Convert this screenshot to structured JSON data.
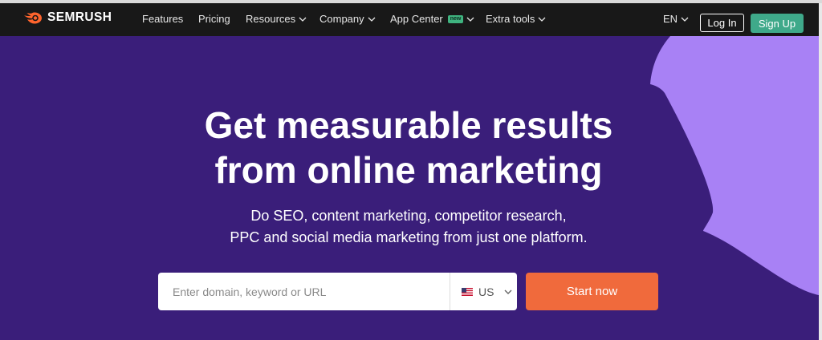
{
  "brand": {
    "name": "SEMRUSH",
    "logo_icon": "semrush-fireball-icon",
    "accent": "#ff642d"
  },
  "nav": {
    "items": [
      {
        "label": "Features",
        "dropdown": false
      },
      {
        "label": "Pricing",
        "dropdown": false
      },
      {
        "label": "Resources",
        "dropdown": true
      },
      {
        "label": "Company",
        "dropdown": true
      },
      {
        "label": "App Center",
        "dropdown": true,
        "badge": "new"
      },
      {
        "label": "Extra tools",
        "dropdown": true
      }
    ],
    "language": "EN",
    "login_label": "Log In",
    "signup_label": "Sign Up"
  },
  "hero": {
    "title_line1": "Get measurable results",
    "title_line2": "from online marketing",
    "subtitle_line1": "Do SEO, content marketing, competitor research,",
    "subtitle_line2": "PPC and social media marketing from just one platform.",
    "search_placeholder": "Enter domain, keyword or URL",
    "search_value": "",
    "country": "US",
    "country_flag_icon": "us-flag-icon",
    "cta_label": "Start now"
  },
  "colors": {
    "nav_bg": "#181818",
    "hero_bg": "#3a1e7a",
    "hero_shape": "#a881f5",
    "signup_bg": "#3fa98a",
    "cta_bg": "#f06a3c"
  }
}
